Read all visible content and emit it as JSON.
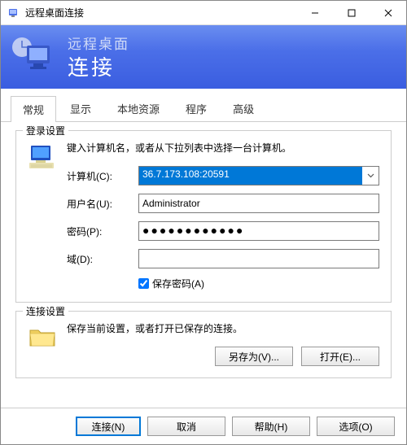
{
  "window": {
    "title": "远程桌面连接"
  },
  "banner": {
    "sub": "远程桌面",
    "main": "连接"
  },
  "tabs": {
    "general": "常规",
    "display": "显示",
    "local": "本地资源",
    "programs": "程序",
    "advanced": "高级"
  },
  "login_group": {
    "title": "登录设置",
    "instruction": "键入计算机名，或者从下拉列表中选择一台计算机。",
    "computer_label": "计算机(C):",
    "computer_value": "36.7.173.108:20591",
    "user_label": "用户名(U):",
    "user_value": "Administrator",
    "password_label": "密码(P):",
    "password_value": "●●●●●●●●●●●●",
    "domain_label": "域(D):",
    "domain_value": "",
    "save_password": "保存密码(A)"
  },
  "conn_group": {
    "title": "连接设置",
    "instruction": "保存当前设置，或者打开已保存的连接。",
    "save_as": "另存为(V)...",
    "open": "打开(E)..."
  },
  "buttons": {
    "connect": "连接(N)",
    "cancel": "取消",
    "help": "帮助(H)",
    "options": "选项(O)"
  }
}
